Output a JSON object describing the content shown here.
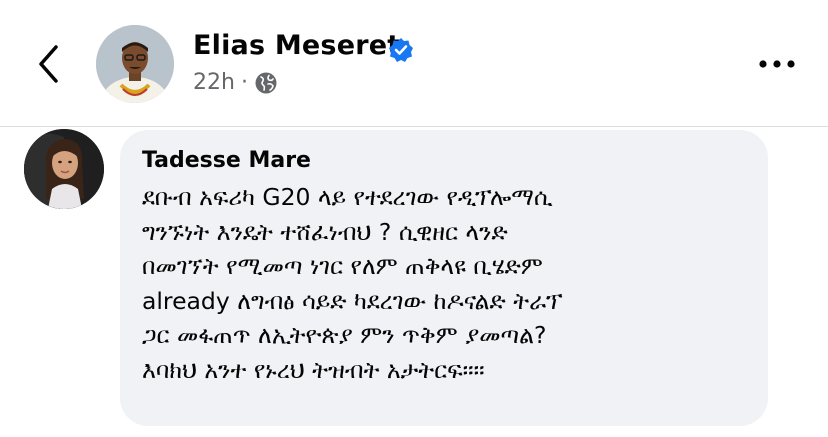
{
  "post": {
    "author_name": "Elias Meseret",
    "verified": true,
    "timestamp": "22h",
    "separator": "·",
    "audience_icon": "globe-icon"
  },
  "header": {
    "back_icon": "chevron-left-icon",
    "more_icon": "more-horizontal-icon"
  },
  "comment": {
    "author": "Tadesse Mare",
    "lines": [
      "ደቡብ አፍሪካ G20 ላይ የተደረገው የዲፕሎማሲ",
      "ግንኙነት እንዴት ተሸፈነብህ ? ሲዊዘር ላንድ",
      "በመገኘት የሚመጣ ነገር የለም ጠቅላዩ ቢሄድም",
      "already ለግብፅ ሳይድ ካደረገው ከዶናልድ ትራፕ",
      "ጋር መፋጠጥ ለኢትዮጵያ ምን ጥቅም ያመጣል?",
      "እባክህ አንተ የኑረህ ትዝብት አታትርፍ።።"
    ]
  },
  "colors": {
    "verified": "#1877f2",
    "meta": "#65676b",
    "bubble": "#f0f2f5",
    "text": "#050505"
  }
}
